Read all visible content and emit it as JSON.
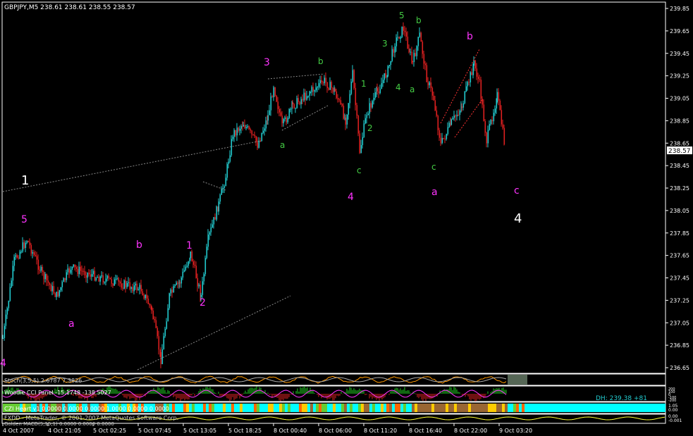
{
  "header": {
    "symbol_info": "GBPJPY,M5  238.61 238.61 238.55 238.57"
  },
  "colors": {
    "background": "#000000",
    "axis": "#ffffff",
    "candle": "#22ccd0",
    "bear": "#e02020",
    "wave_label_magenta": "#ff33ff",
    "wave_label_green": "#44cc44",
    "wave_label_white": "#ffffff",
    "trendline": "#888888",
    "channel_red": "#ff3333",
    "current_price_bg": "#ffffff"
  },
  "price_axis": {
    "labels": [
      "239.85",
      "239.65",
      "239.45",
      "239.25",
      "239.05",
      "238.85",
      "238.65",
      "238.45",
      "238.25",
      "238.05",
      "237.85",
      "237.65",
      "237.45",
      "237.25",
      "237.05",
      "236.85",
      "236.65"
    ],
    "current_price": "238.57"
  },
  "time_axis": {
    "labels": [
      "4 Oct 2007",
      "4 Oct 21:05",
      "5 Oct 02:25",
      "5 Oct 07:45",
      "5 Oct 13:05",
      "5 Oct 18:25",
      "8 Oct 00:40",
      "8 Oct 06:00",
      "8 Oct 11:20",
      "8 Oct 16:40",
      "8 Oct 22:00",
      "9 Oct 03:20"
    ]
  },
  "wave_labels": [
    {
      "text": "4",
      "color": "magenta"
    },
    {
      "text": "5",
      "color": "magenta"
    },
    {
      "text": "a",
      "color": "magenta"
    },
    {
      "text": "b",
      "color": "magenta"
    },
    {
      "text": "1",
      "color": "magenta"
    },
    {
      "text": "2",
      "color": "magenta"
    },
    {
      "text": "3",
      "color": "magenta"
    },
    {
      "text": "4",
      "color": "magenta"
    },
    {
      "text": "a",
      "color": "magenta"
    },
    {
      "text": "b",
      "color": "magenta"
    },
    {
      "text": "c",
      "color": "magenta"
    },
    {
      "text": "1",
      "color": "white"
    },
    {
      "text": "4",
      "color": "white"
    },
    {
      "text": "a",
      "color": "green"
    },
    {
      "text": "b",
      "color": "green"
    },
    {
      "text": "c",
      "color": "green"
    },
    {
      "text": "1",
      "color": "green"
    },
    {
      "text": "2",
      "color": "green"
    },
    {
      "text": "3",
      "color": "green"
    },
    {
      "text": "4",
      "color": "green"
    },
    {
      "text": "5",
      "color": "green"
    },
    {
      "text": "a",
      "color": "green"
    },
    {
      "text": "b",
      "color": "green"
    },
    {
      "text": "c",
      "color": "green"
    }
  ],
  "indicators": {
    "stoch_label": "Stoch(3,5,5) 2.6787 7.3826",
    "cci_label": "Woodie CCI Panel -15.1748 -138.5027",
    "cci_right_values": [
      "200",
      "100",
      "0",
      "-100",
      "-200"
    ],
    "dh_label": "DH: 239.38 +81",
    "heart_label": "CZI Heart v1 0.0000 0.0000 0.0000 1.0000 0.0000 0.0000",
    "heart_right_values": [
      "1.05",
      "0.00"
    ],
    "fxdd_label": "FXDD - MetaTrader, © 2001-2007 MetaQuotes Software Corp.",
    "macd_label": "Golden MACD(5,15,1) 0.0000 0.0000 0.0000",
    "macd_right_values": [
      "0.00",
      "-0.001"
    ]
  }
}
